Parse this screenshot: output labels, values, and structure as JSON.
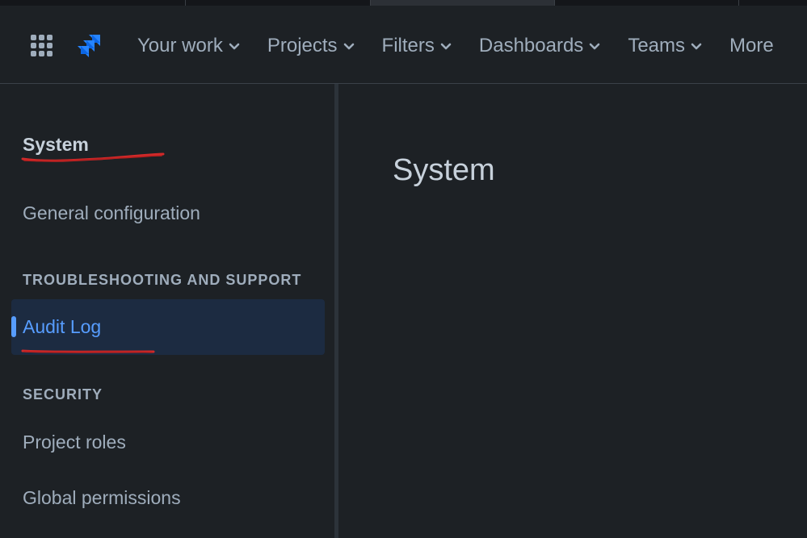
{
  "header": {
    "nav": [
      {
        "label": "Your work"
      },
      {
        "label": "Projects"
      },
      {
        "label": "Filters"
      },
      {
        "label": "Dashboards"
      },
      {
        "label": "Teams"
      },
      {
        "label": "More"
      }
    ],
    "icons": {
      "apps": "grid-icon",
      "logo": "jira-logo",
      "chevron": "chevron-down-icon"
    }
  },
  "sidebar": {
    "title": "System",
    "general_configuration": "General configuration",
    "section_troubleshooting": "TROUBLESHOOTING AND SUPPORT",
    "audit_log": "Audit Log",
    "section_security": "SECURITY",
    "project_roles": "Project roles",
    "global_permissions": "Global permissions"
  },
  "main": {
    "title": "System"
  },
  "colors": {
    "background": "#1d2125",
    "active_item_bg": "#1c2b41",
    "accent": "#579dff",
    "annotation_red": "#d12a2a"
  }
}
